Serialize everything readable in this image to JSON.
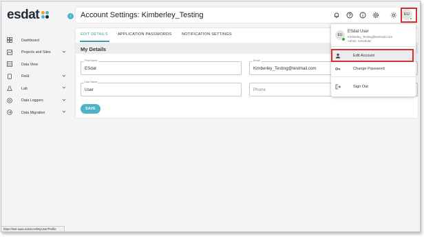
{
  "app": {
    "logo_text": "esdat",
    "status_url": "https://test-saas.esdat.net/MyUser/Profile"
  },
  "sidebar": {
    "items": [
      {
        "label": "Dashboard",
        "icon": "dashboard-icon",
        "has_chevron": false
      },
      {
        "label": "Projects and Sites",
        "icon": "map-icon",
        "has_chevron": true
      },
      {
        "label": "Data View",
        "icon": "table-icon",
        "has_chevron": false
      },
      {
        "label": "Field",
        "icon": "tablet-icon",
        "has_chevron": true
      },
      {
        "label": "Lab",
        "icon": "flask-icon",
        "has_chevron": true
      },
      {
        "label": "Data Loggers",
        "icon": "logger-icon",
        "has_chevron": true
      },
      {
        "label": "Data Migration",
        "icon": "migration-icon",
        "has_chevron": true
      }
    ]
  },
  "header": {
    "title": "Account Settings: Kimberley_Testing",
    "avatar_initials": "EU"
  },
  "tabs": [
    {
      "label": "EDIT DETAILS",
      "active": true
    },
    {
      "label": "APPLICATION PASSWORDS",
      "active": false
    },
    {
      "label": "NOTIFICATION SETTINGS",
      "active": false
    }
  ],
  "form": {
    "section_title": "My Details",
    "first_name": {
      "label": "First Name",
      "value": "ESdat"
    },
    "last_name": {
      "label": "Last Name",
      "value": "User"
    },
    "email": {
      "label": "Email",
      "value": "Kimberley_Testing@testmail.com"
    },
    "phone": {
      "placeholder": "Phone"
    },
    "save_label": "SAVE"
  },
  "user_menu": {
    "initials": "EU",
    "name": "ESdat User",
    "email": "Kimberley_Testing@testmail.com",
    "roles": "Admin, Scheduler",
    "items": [
      {
        "label": "Edit Account",
        "highlighted": true
      },
      {
        "label": "Change Password",
        "highlighted": false
      },
      {
        "label": "Sign Out",
        "highlighted": false
      }
    ]
  },
  "colors": {
    "accent": "#4fb3c8",
    "highlight_box": "#d32f2f",
    "online_dot": "#43a047"
  }
}
